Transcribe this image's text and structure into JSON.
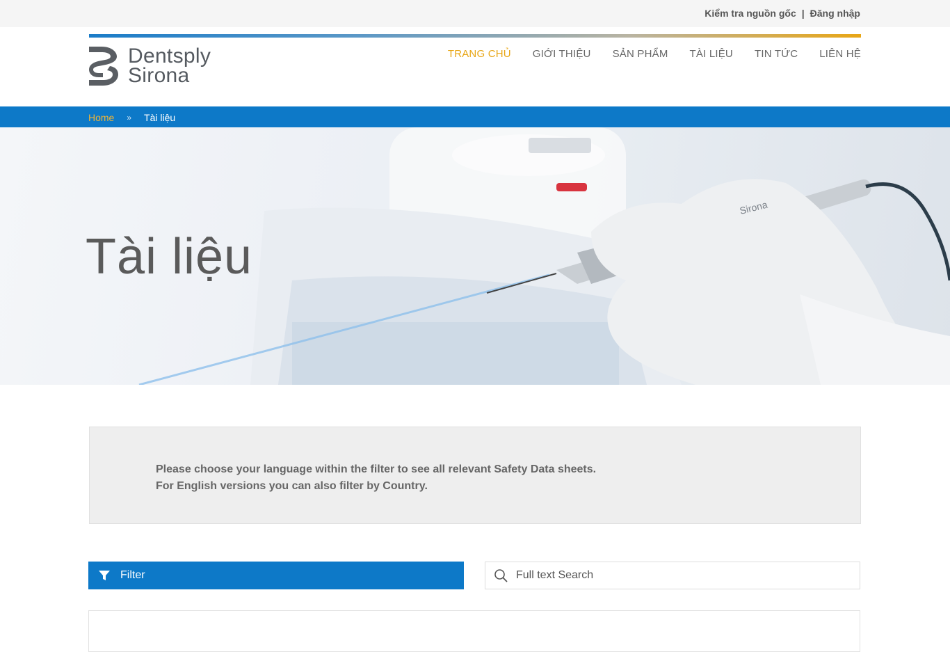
{
  "topbar": {
    "verify_link": "Kiểm tra nguồn gốc",
    "separator": "|",
    "login_link": "Đăng nhập"
  },
  "logo": {
    "line1": "Dentsply",
    "line2": "Sirona"
  },
  "nav": {
    "items": [
      {
        "label": "TRANG CHỦ",
        "active": true
      },
      {
        "label": "GIỚI THIỆU",
        "active": false
      },
      {
        "label": "SẢN PHẨM",
        "active": false
      },
      {
        "label": "TÀI LIỆU",
        "active": false
      },
      {
        "label": "TIN TỨC",
        "active": false
      },
      {
        "label": "LIÊN HỆ",
        "active": false
      }
    ]
  },
  "breadcrumb": {
    "home": "Home",
    "separator": "»",
    "current": "Tài liệu"
  },
  "hero": {
    "title": "Tài liệu",
    "image_text": "Sirona"
  },
  "notice": {
    "line1": "Please choose your language within the filter to see all relevant Safety Data sheets.",
    "line2": "For English versions you can also filter by Country."
  },
  "filter": {
    "label": "Filter"
  },
  "search": {
    "placeholder": "Full text Search",
    "value": ""
  },
  "colors": {
    "brand_blue": "#0d79c8",
    "accent_gold": "#e8a615",
    "text_gray": "#555555"
  },
  "icons": {
    "filter": "funnel-icon",
    "search": "search-icon",
    "breadcrumb_separator": "double-chevron-right-icon"
  }
}
